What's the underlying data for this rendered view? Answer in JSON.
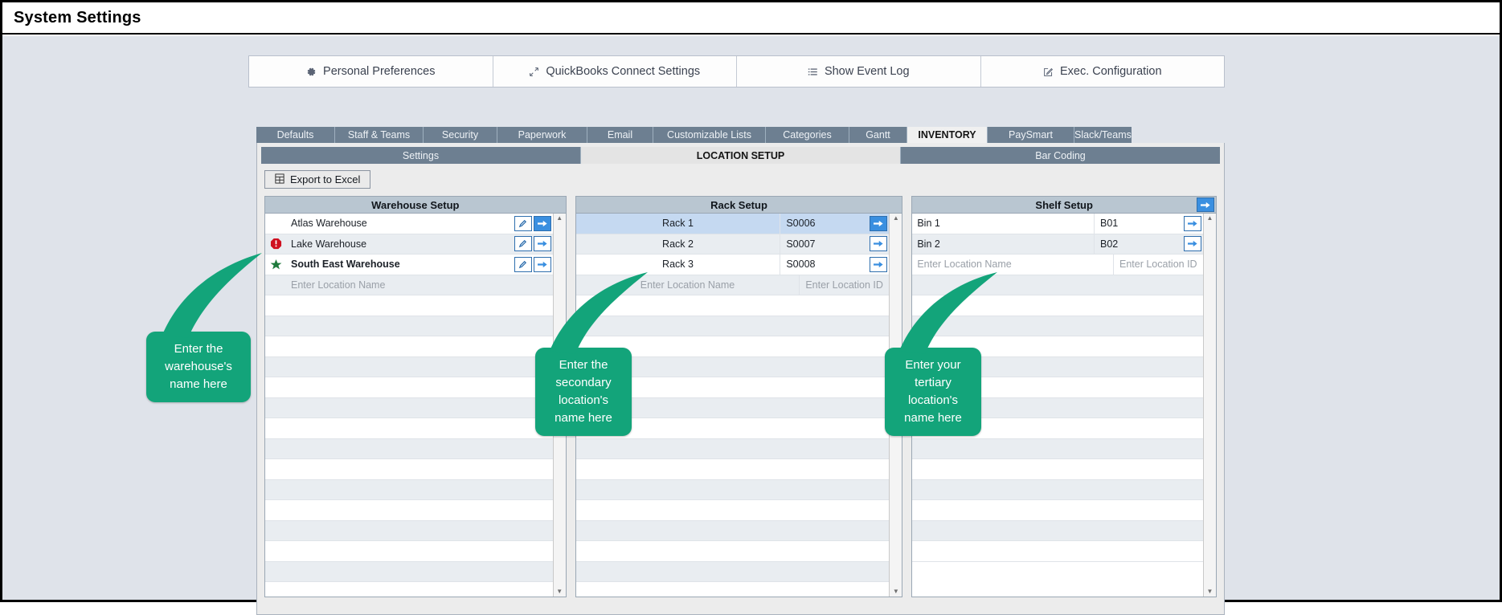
{
  "window": {
    "title": "System Settings"
  },
  "topbar": {
    "buttons": [
      {
        "label": "Personal Preferences",
        "icon": "gear-icon"
      },
      {
        "label": "QuickBooks Connect Settings",
        "icon": "arrows-expand-icon"
      },
      {
        "label": "Show Event Log",
        "icon": "list-icon"
      },
      {
        "label": "Exec. Configuration",
        "icon": "edit-square-icon"
      }
    ]
  },
  "tabs": {
    "items": [
      {
        "label": "Defaults",
        "active": false
      },
      {
        "label": "Staff & Teams",
        "active": false
      },
      {
        "label": "Security",
        "active": false
      },
      {
        "label": "Paperwork",
        "active": false
      },
      {
        "label": "Email",
        "active": false
      },
      {
        "label": "Customizable Lists",
        "active": false
      },
      {
        "label": "Categories",
        "active": false
      },
      {
        "label": "Gantt",
        "active": false
      },
      {
        "label": "INVENTORY",
        "active": true
      },
      {
        "label": "PaySmart",
        "active": false
      },
      {
        "label": "Slack/Teams",
        "active": false
      }
    ]
  },
  "subtabs": {
    "items": [
      {
        "label": "Settings",
        "active": false
      },
      {
        "label": "LOCATION SETUP",
        "active": true
      },
      {
        "label": "Bar Coding",
        "active": false
      }
    ]
  },
  "toolbar": {
    "export_label": "Export to Excel",
    "export_icon": "excel-icon"
  },
  "grids": {
    "warehouse": {
      "title": "Warehouse Setup",
      "rows": [
        {
          "flag": "",
          "name": "Atlas Warehouse",
          "bold": false,
          "selected": false,
          "placeholder": false,
          "buttons": [
            "edit",
            "arrow-filled"
          ]
        },
        {
          "flag": "stop-icon",
          "name": "Lake Warehouse",
          "bold": false,
          "selected": false,
          "placeholder": false,
          "buttons": [
            "edit",
            "arrow"
          ]
        },
        {
          "flag": "star-icon",
          "name": "South East Warehouse",
          "bold": true,
          "selected": false,
          "placeholder": false,
          "buttons": [
            "edit",
            "arrow"
          ]
        },
        {
          "flag": "",
          "name": "Enter Location Name",
          "bold": false,
          "selected": false,
          "placeholder": true,
          "buttons": []
        }
      ]
    },
    "rack": {
      "title": "Rack Setup",
      "rows": [
        {
          "name": "Rack 1",
          "id": "S0006",
          "selected": true,
          "placeholder": false,
          "buttons": [
            "arrow-filled"
          ]
        },
        {
          "name": "Rack 2",
          "id": "S0007",
          "selected": false,
          "placeholder": false,
          "buttons": [
            "arrow"
          ]
        },
        {
          "name": "Rack 3",
          "id": "S0008",
          "selected": false,
          "placeholder": false,
          "buttons": [
            "arrow"
          ]
        },
        {
          "name": "Enter Location Name",
          "id": "Enter Location ID",
          "selected": false,
          "placeholder": true,
          "buttons": []
        }
      ]
    },
    "shelf": {
      "title": "Shelf Setup",
      "header_button": "arrow-filled",
      "rows": [
        {
          "name": "Bin 1",
          "id": "B01",
          "selected": false,
          "placeholder": false,
          "buttons": [
            "arrow"
          ]
        },
        {
          "name": "Bin 2",
          "id": "B02",
          "selected": false,
          "placeholder": false,
          "buttons": [
            "arrow"
          ]
        },
        {
          "name": "Enter Location Name",
          "id": "Enter Location ID",
          "selected": false,
          "placeholder": true,
          "buttons": []
        }
      ]
    }
  },
  "callouts": [
    {
      "text": "Enter the warehouse's name here"
    },
    {
      "text": "Enter the secondary location's name here"
    },
    {
      "text": "Enter your tertiary location's name here"
    }
  ],
  "colors": {
    "callout_green": "#13a47a",
    "tab_blue_gray": "#6d7f91",
    "grid_header": "#b9c6d1",
    "accent_blue": "#3a8fe0",
    "row_selected": "#c5d9f1"
  }
}
